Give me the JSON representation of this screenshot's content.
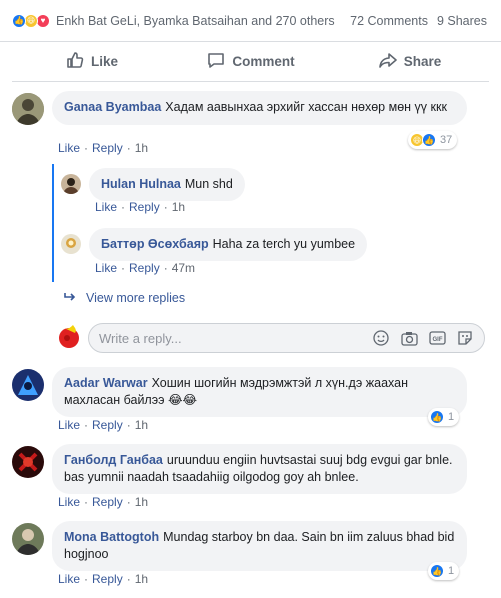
{
  "summary": {
    "reaction_icons": [
      "like-icon",
      "haha-icon",
      "love-icon"
    ],
    "names": "Enkh Bat GeLi, Byamka Batsaihan and 270 others",
    "comments_count": "72 Comments",
    "shares_count": "9 Shares"
  },
  "actions": {
    "like_label": "Like",
    "comment_label": "Comment",
    "share_label": "Share"
  },
  "comments": [
    {
      "author": "Ganaa Byambaa",
      "text": "Хадам аавынхаа эрхийг хассан нөхөр мөн үү ккк",
      "like": "Like",
      "reply": "Reply",
      "time": "1h",
      "reactions": "37",
      "reaction_icons": [
        "haha-icon",
        "like-icon"
      ]
    },
    {
      "author": "Hulan Hulnaa",
      "text": "Mun shd",
      "like": "Like",
      "reply": "Reply",
      "time": "1h"
    },
    {
      "author": "Баттөр Өсөхбаяр",
      "text": "Haha za terch yu yumbee",
      "like": "Like",
      "reply": "Reply",
      "time": "47m"
    },
    {
      "author": "Aadar Warwar",
      "text": "Хошин шогийн мэдрэмжтэй л хүн.дэ жаахан махласан байлээ 😂😂",
      "like": "Like",
      "reply": "Reply",
      "time": "1h",
      "reactions": "1",
      "reaction_icons": [
        "like-icon"
      ]
    },
    {
      "author": "Ганболд Ганбаа",
      "text": "uruunduu engiin huvtsastai suuj bdg evgui gar bnle. bas yumnii naadah tsaadahiig oilgodog goy ah bnlee.",
      "like": "Like",
      "reply": "Reply",
      "time": "1h"
    },
    {
      "author": "Mona Battogtoh",
      "text": "Mundag starboy bn daa. Sain bn iim zaluus bhad bid hogjnoo",
      "like": "Like",
      "reply": "Reply",
      "time": "1h",
      "reactions": "1",
      "reaction_icons": [
        "like-icon"
      ]
    }
  ],
  "view_more_replies": "View more replies",
  "reply_box": {
    "placeholder": "Write a reply...",
    "icons": [
      "emoji-icon",
      "camera-icon",
      "gif-icon",
      "sticker-icon"
    ]
  },
  "colors": {
    "link": "#385898",
    "like_blue": "#1877f2",
    "bubble_bg": "#f2f3f5",
    "meta_gray": "#606770"
  }
}
